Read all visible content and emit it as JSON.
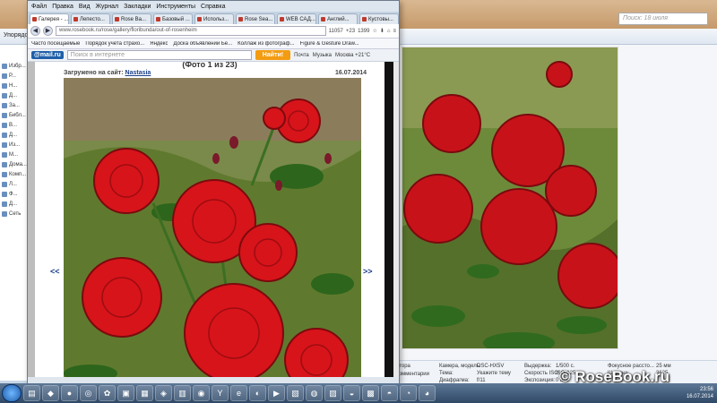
{
  "background_window": {
    "search_placeholder": "Поиск: 18 июля",
    "toolbar_label": "Упорядо...",
    "nav_items": [
      "Избр...",
      "Р...",
      "Н...",
      "Д...",
      "За...",
      "Библ...",
      "В...",
      "Д...",
      "Из...",
      "М...",
      "Дома...",
      "Комп...",
      "Л...",
      "Ф...",
      "Д...",
      "Сеть"
    ],
    "details": [
      {
        "label": "Камера, модель:",
        "value": "DSC-HX5V"
      },
      {
        "label": "Тема:",
        "value": "Укажите тему"
      },
      {
        "label": "Диафрагма:",
        "value": "f/11"
      },
      {
        "label": "Выдержка:",
        "value": "1/500 с."
      },
      {
        "label": "Скорость ISO:",
        "value": "ISO-125"
      },
      {
        "label": "Экспозиция:",
        "value": "0 шаг"
      },
      {
        "label": "Фокусное рассто...",
        "value": "25 мм"
      },
      {
        "label": "Ширина:",
        "value": "3625"
      }
    ],
    "left_fragments": [
      "атора",
      "комментарии"
    ],
    "watermark": "© RoseBook.ru"
  },
  "browser": {
    "menu": [
      "Файл",
      "Правка",
      "Вид",
      "Журнал",
      "Закладки",
      "Инструменты",
      "Справка"
    ],
    "tabs": [
      {
        "label": "Галерея - ..."
      },
      {
        "label": "Лепесто..."
      },
      {
        "label": "Rose Ва..."
      },
      {
        "label": "Базовый ..."
      },
      {
        "label": "Использ..."
      },
      {
        "label": "Rose Sea..."
      },
      {
        "label": "WEB САД..."
      },
      {
        "label": "Англий..."
      },
      {
        "label": "Кустовы..."
      }
    ],
    "url": "www.rosebook.ru/rose/gallery/floribunda/out-of-rosenheim",
    "address_extras": [
      "11057",
      "+23",
      "1399"
    ],
    "bookmarks": [
      "Часто посещаемые",
      "Порядок учета страхо...",
      "Яндекс",
      "Доска объявлений Бе...",
      "Коллаж из фотограф...",
      "Figure & Gesture Draw..."
    ],
    "mailru_label": "@mail.ru",
    "search_placeholder": "Поиск в интернете",
    "find_label": "Найти!",
    "searchbar_items": [
      "Почта",
      "Музыка",
      "Москва +21°C"
    ]
  },
  "gallery": {
    "counter": "(Фото 1 из 23)",
    "uploaded_label": "Загружено на сайт:",
    "uploader": "Nastasia",
    "date": "16.07.2014",
    "prev": "<<",
    "next": ">>"
  },
  "taskbar": {
    "time": "23:56",
    "date": "16.07.2014"
  },
  "colors": {
    "accent": "#1a3e8a",
    "find_button": "#f39c12",
    "rose": "#d7141a"
  }
}
